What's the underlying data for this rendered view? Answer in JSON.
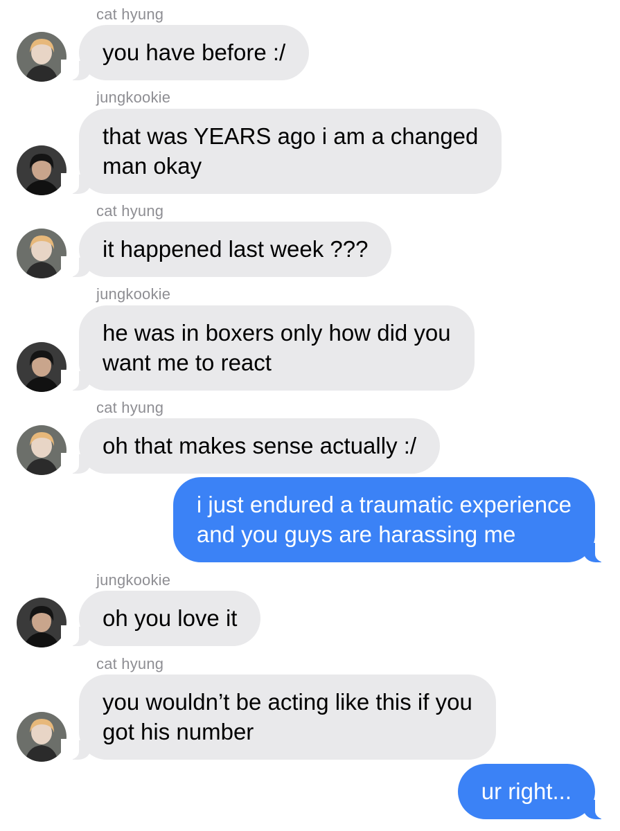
{
  "colors": {
    "received_bubble": "#e9e9eb",
    "sent_bubble": "#3b82f6",
    "sender_name": "#8e8e93"
  },
  "messages": [
    {
      "sender": "cat hyung",
      "avatar_icon": "cat-hyung-avatar-icon",
      "lines": [
        "you have before :/"
      ]
    },
    {
      "sender": "jungkookie",
      "avatar_icon": "jungkookie-avatar-icon",
      "lines": [
        "that was YEARS ago i am a changed",
        "man okay"
      ]
    },
    {
      "sender": "cat hyung",
      "avatar_icon": "cat-hyung-avatar-icon",
      "lines": [
        "it happened last week ???"
      ]
    },
    {
      "sender": "jungkookie",
      "avatar_icon": "jungkookie-avatar-icon",
      "lines": [
        "he was in boxers only how did you",
        "want me to react"
      ]
    },
    {
      "sender": "cat hyung",
      "avatar_icon": "cat-hyung-avatar-icon",
      "lines": [
        "oh that makes sense actually :/"
      ]
    },
    {
      "sender": "me",
      "lines": [
        "i just endured a traumatic experience",
        "and you guys are harassing me"
      ]
    },
    {
      "sender": "jungkookie",
      "avatar_icon": "jungkookie-avatar-icon",
      "lines": [
        "oh you love it"
      ]
    },
    {
      "sender": "cat hyung",
      "avatar_icon": "cat-hyung-avatar-icon",
      "lines": [
        "you wouldn’t be acting like this if you",
        "got his number"
      ]
    },
    {
      "sender": "me",
      "lines": [
        "ur right..."
      ]
    }
  ]
}
